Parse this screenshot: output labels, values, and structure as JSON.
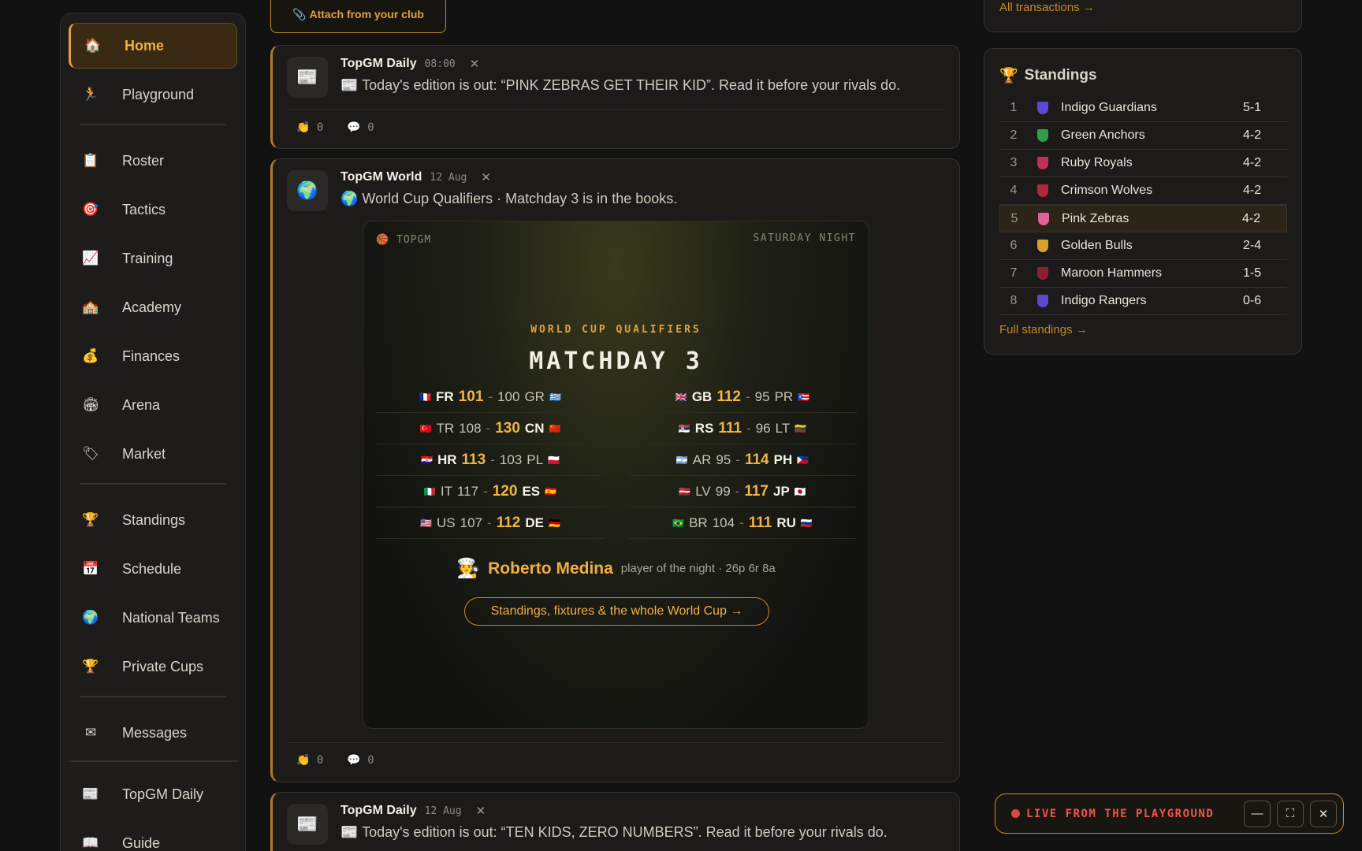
{
  "sidebar": {
    "items": [
      {
        "label": "Home",
        "icon": "home-icon",
        "glyph": "🏠",
        "active": true
      },
      {
        "label": "Playground",
        "icon": "runner-icon",
        "glyph": "🏃"
      },
      {
        "label": "Roster",
        "icon": "clipboard-icon",
        "glyph": "📋"
      },
      {
        "label": "Tactics",
        "icon": "target-icon",
        "glyph": "🎯"
      },
      {
        "label": "Training",
        "icon": "chart-icon",
        "glyph": "📈"
      },
      {
        "label": "Academy",
        "icon": "school-icon",
        "glyph": "🏫"
      },
      {
        "label": "Finances",
        "icon": "moneybag-icon",
        "glyph": "💰"
      },
      {
        "label": "Arena",
        "icon": "stadium-icon",
        "glyph": "🏟"
      },
      {
        "label": "Market",
        "icon": "tag-icon",
        "glyph": "🏷"
      },
      {
        "label": "Standings",
        "icon": "trophy-icon",
        "glyph": "🏆"
      },
      {
        "label": "Schedule",
        "icon": "calendar-icon",
        "glyph": "📅"
      },
      {
        "label": "National Teams",
        "icon": "globe-icon",
        "glyph": "🌍"
      },
      {
        "label": "Private Cups",
        "icon": "trophy-icon",
        "glyph": "🏆"
      },
      {
        "label": "Messages",
        "icon": "envelope-icon",
        "glyph": "✉"
      },
      {
        "label": "TopGM Daily",
        "icon": "newspaper-icon",
        "glyph": "📰"
      },
      {
        "label": "Guide",
        "icon": "book-icon",
        "glyph": "📖"
      }
    ]
  },
  "feed": {
    "attach_label": "Attach from your club",
    "posts": [
      {
        "author": "TopGM Daily",
        "time": "08:00",
        "text": "📰 Today's edition is out: “PINK ZEBRAS GET THEIR KID”. Read it before your rivals do.",
        "claps": "0",
        "comments": "0"
      },
      {
        "author": "TopGM World",
        "time": "12 Aug",
        "text": "🌍 World Cup Qualifiers · Matchday 3 is in the books.",
        "claps": "0",
        "comments": "0"
      },
      {
        "author": "TopGM Daily",
        "time": "12 Aug",
        "text": "📰 Today's edition is out: “TEN KIDS, ZERO NUMBERS”. Read it before your rivals do."
      }
    ]
  },
  "card": {
    "brand": "TOPGM",
    "night": "SATURDAY NIGHT",
    "subtitle": "WORLD CUP QUALIFIERS",
    "title": "MATCHDAY 3",
    "left_games": [
      {
        "home": "FR",
        "home_flag": "🇫🇷",
        "home_score": "101",
        "away": "GR",
        "away_flag": "🇬🇷",
        "away_score": "100",
        "winner": "home"
      },
      {
        "home": "TR",
        "home_flag": "🇹🇷",
        "home_score": "108",
        "away": "CN",
        "away_flag": "🇨🇳",
        "away_score": "130",
        "winner": "away"
      },
      {
        "home": "HR",
        "home_flag": "🇭🇷",
        "home_score": "113",
        "away": "PL",
        "away_flag": "🇵🇱",
        "away_score": "103",
        "winner": "home"
      },
      {
        "home": "IT",
        "home_flag": "🇮🇹",
        "home_score": "117",
        "away": "ES",
        "away_flag": "🇪🇸",
        "away_score": "120",
        "winner": "away"
      },
      {
        "home": "US",
        "home_flag": "🇺🇸",
        "home_score": "107",
        "away": "DE",
        "away_flag": "🇩🇪",
        "away_score": "112",
        "winner": "away"
      }
    ],
    "right_games": [
      {
        "home": "GB",
        "home_flag": "🇬🇧",
        "home_score": "112",
        "away": "PR",
        "away_flag": "🇵🇷",
        "away_score": "95",
        "winner": "home"
      },
      {
        "home": "RS",
        "home_flag": "🇷🇸",
        "home_score": "111",
        "away": "LT",
        "away_flag": "🇱🇹",
        "away_score": "96",
        "winner": "home"
      },
      {
        "home": "AR",
        "home_flag": "🇦🇷",
        "home_score": "95",
        "away": "PH",
        "away_flag": "🇵🇭",
        "away_score": "114",
        "winner": "away"
      },
      {
        "home": "LV",
        "home_flag": "🇱🇻",
        "home_score": "99",
        "away": "JP",
        "away_flag": "🇯🇵",
        "away_score": "117",
        "winner": "away"
      },
      {
        "home": "BR",
        "home_flag": "🇧🇷",
        "home_score": "104",
        "away": "RU",
        "away_flag": "🇷🇺",
        "away_score": "111",
        "winner": "away"
      }
    ],
    "potn_name": "Roberto Medina",
    "potn_desc": "player of the night · 26p 6r 8a",
    "cta": "Standings, fixtures & the whole World Cup →"
  },
  "right": {
    "tx_link": "All transactions →",
    "standings_title": "Standings",
    "standings_link": "Full standings →",
    "rows": [
      {
        "rank": "1",
        "team": "Indigo Guardians",
        "record": "5-1",
        "color": "#5b4ad1"
      },
      {
        "rank": "2",
        "team": "Green Anchors",
        "record": "4-2",
        "color": "#2f9e4a"
      },
      {
        "rank": "3",
        "team": "Ruby Royals",
        "record": "4-2",
        "color": "#c2305a"
      },
      {
        "rank": "4",
        "team": "Crimson Wolves",
        "record": "4-2",
        "color": "#b0263a"
      },
      {
        "rank": "5",
        "team": "Pink Zebras",
        "record": "4-2",
        "color": "#e0609a",
        "highlight": true
      },
      {
        "rank": "6",
        "team": "Golden Bulls",
        "record": "2-4",
        "color": "#d8a22a"
      },
      {
        "rank": "7",
        "team": "Maroon Hammers",
        "record": "1-5",
        "color": "#8a2030"
      },
      {
        "rank": "8",
        "team": "Indigo Rangers",
        "record": "0-6",
        "color": "#5b4ad1"
      }
    ]
  },
  "live": {
    "label": "LIVE FROM THE PLAYGROUND"
  }
}
